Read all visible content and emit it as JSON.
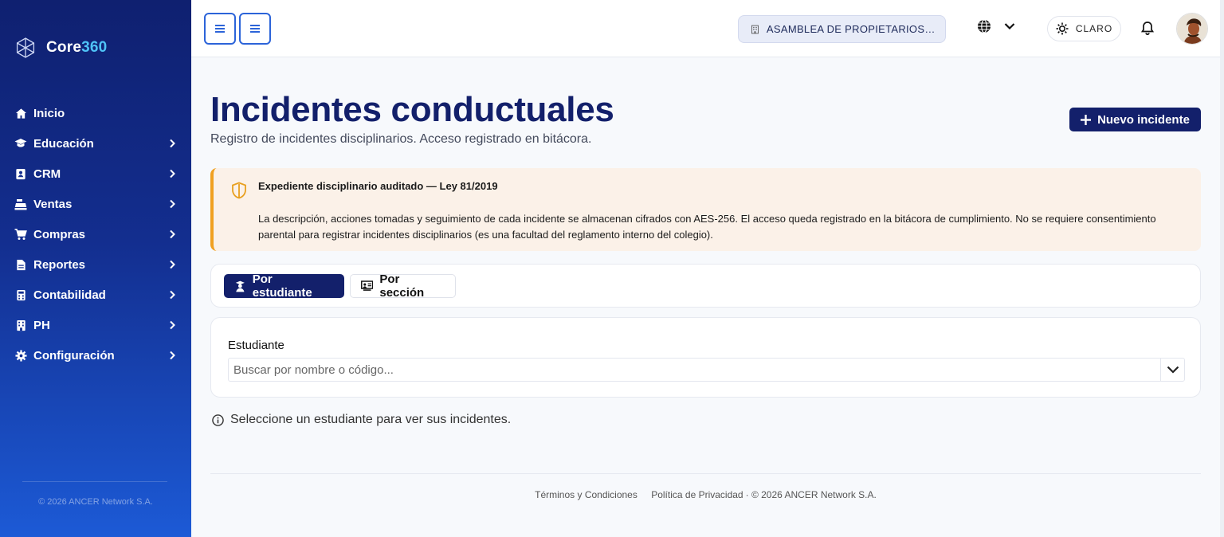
{
  "sidebar": {
    "brand": {
      "prefix": "Core",
      "suffix": "360"
    },
    "items": [
      {
        "label": "Inicio",
        "icon": "home-icon",
        "has_submenu": false
      },
      {
        "label": "Educación",
        "icon": "graduation-cap-icon",
        "has_submenu": true
      },
      {
        "label": "CRM",
        "icon": "contact-card-icon",
        "has_submenu": true
      },
      {
        "label": "Ventas",
        "icon": "cash-register-icon",
        "has_submenu": true
      },
      {
        "label": "Compras",
        "icon": "cart-icon",
        "has_submenu": true
      },
      {
        "label": "Reportes",
        "icon": "file-report-icon",
        "has_submenu": true
      },
      {
        "label": "Contabilidad",
        "icon": "calculator-icon",
        "has_submenu": true
      },
      {
        "label": "PH",
        "icon": "building-icon",
        "has_submenu": true
      },
      {
        "label": "Configuración",
        "icon": "gear-icon",
        "has_submenu": true
      }
    ],
    "copyright": "© 2026 ANCER Network S.A."
  },
  "topbar": {
    "org_name": "ASAMBLEA DE PROPIETARIOS DE …",
    "theme_label": "CLARO"
  },
  "main": {
    "title": "Incidentes conductuales",
    "subtitle": "Registro de incidentes disciplinarios. Acceso registrado en bitácora.",
    "new_button": "Nuevo incidente",
    "alert": {
      "title": "Expediente disciplinario auditado — Ley 81/2019",
      "body": "La descripción, acciones tomadas y seguimiento de cada incidente se almacenan cifrados con AES-256. El acceso queda registrado en la bitácora de cumplimiento. No se requiere consentimiento parental para registrar incidentes disciplinarios (es una facultad del reglamento interno del colegio)."
    },
    "tabs": [
      {
        "label": "Por estudiante",
        "active": true
      },
      {
        "label": "Por sección",
        "active": false
      }
    ],
    "form": {
      "label": "Estudiante",
      "placeholder": "Buscar por nombre o código..."
    },
    "info": "Seleccione un estudiante para ver sus incidentes."
  },
  "footer": {
    "terms": "Términos y Condiciones",
    "privacy": "Política de Privacidad",
    "copyright": "· © 2026 ANCER Network S.A."
  },
  "colors": {
    "primary": "#13206b",
    "sidebar_top": "#0f2070",
    "sidebar_bottom": "#1c5ad6",
    "brand_accent": "#4fc3f7",
    "alert_bg": "#fbf1e8",
    "alert_border": "#f0a020",
    "menu_button_border": "#2c64d9"
  }
}
